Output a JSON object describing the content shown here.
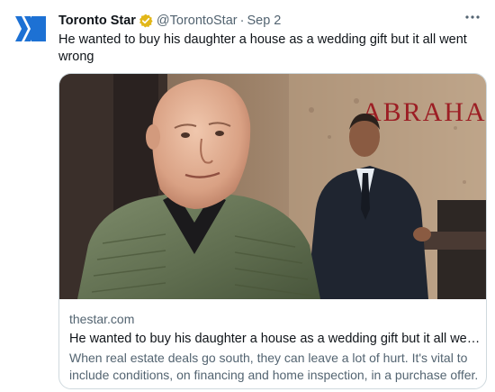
{
  "tweet": {
    "author_name": "Toronto Star",
    "author_handle": "@TorontoStar",
    "separator": "·",
    "date": "Sep 2",
    "text": "He wanted to buy his daughter a house as a wedding gift but it all went wrong",
    "verified": true,
    "avatar_icon": "toronto-star-logo-icon",
    "more_icon": "more-options-icon"
  },
  "link_card": {
    "domain": "thestar.com",
    "title": "He wanted to buy his daughter a house as a wedding gift but it all went...",
    "description": "When real estate deals go south, they can leave a lot of hurt. It's vital to include conditions, on financing and home inspection, in a purchase offer.",
    "image_sign_text": "ABRAHA"
  },
  "colors": {
    "brand_blue": "#1d71d4",
    "verified_gold": "#e2b719",
    "secondary_text": "#536471",
    "card_border": "#cfd9de"
  }
}
